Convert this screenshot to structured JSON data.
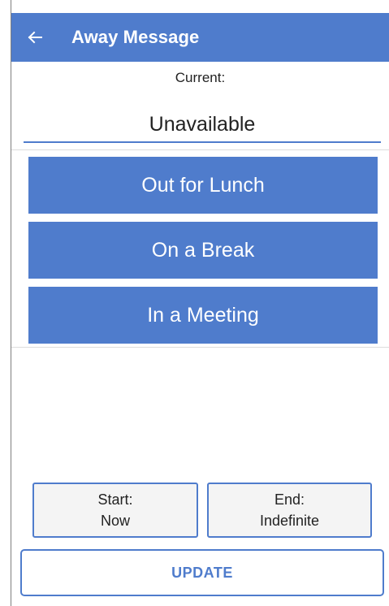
{
  "colors": {
    "accent": "#4f7ccc",
    "button_text": "#ffffff",
    "background": "#ffffff"
  },
  "header": {
    "back_icon": "arrow-left-icon",
    "title": "Away Message"
  },
  "current": {
    "label": "Current:",
    "value": "Unavailable"
  },
  "presets": [
    {
      "label": "Out for Lunch"
    },
    {
      "label": "On a Break"
    },
    {
      "label": "In a Meeting"
    }
  ],
  "schedule": {
    "start": {
      "label": "Start:",
      "value": "Now"
    },
    "end": {
      "label": "End:",
      "value": "Indefinite"
    }
  },
  "actions": {
    "update_label": "UPDATE"
  }
}
